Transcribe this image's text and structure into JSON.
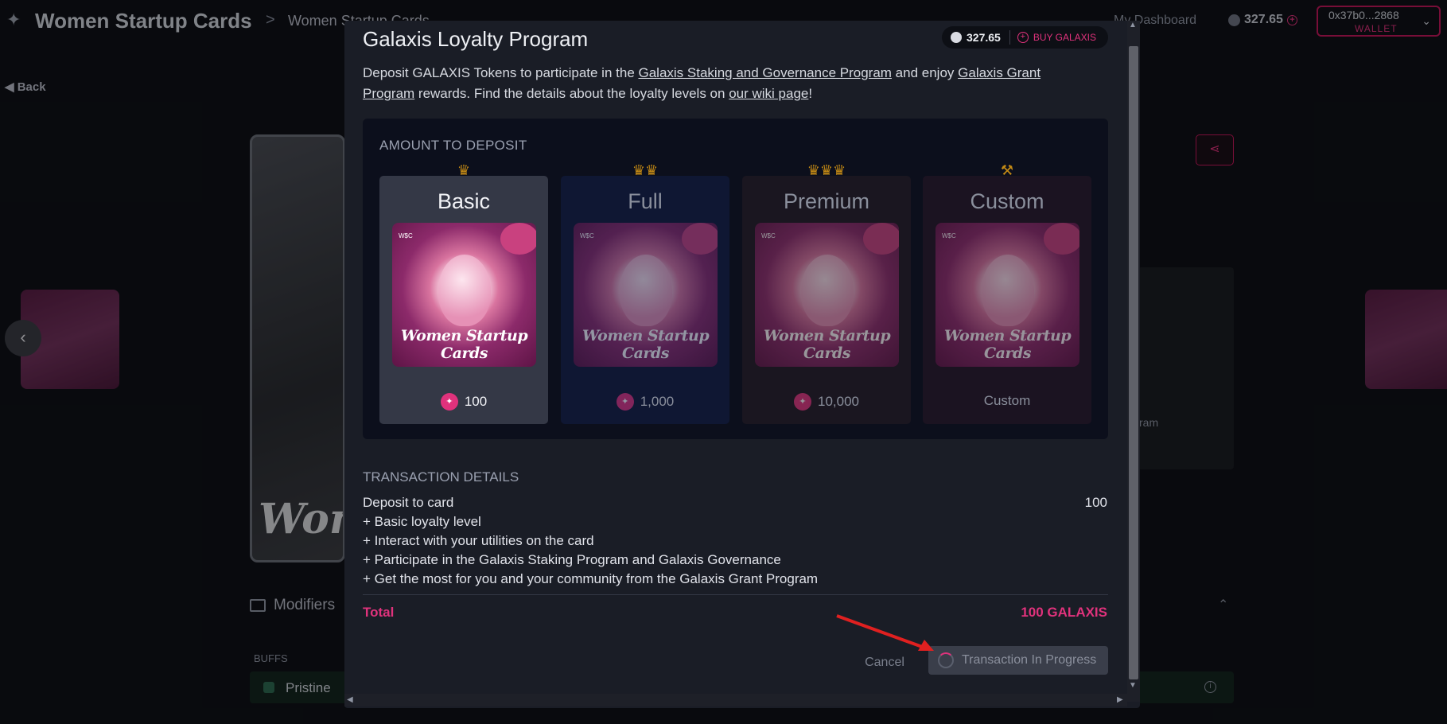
{
  "header": {
    "app_title": "Women Startup Cards",
    "breadcrumb_sep": ">",
    "breadcrumb": "Women Startup Cards",
    "nav_dashboard": "My Dashboard",
    "balance": "327.65",
    "wallet_address": "0x37b0...2868",
    "wallet_label": "WALLET"
  },
  "page": {
    "back_label": "◀ Back",
    "card_text": "Wom",
    "side_panel_text": "ram",
    "modifiers_label": "Modifiers",
    "buffs_label": "BUFFS",
    "pristine_label": "Pristine"
  },
  "modal": {
    "title": "Galaxis Loyalty Program",
    "balance": "327.65",
    "buy_label": "BUY GALAXIS",
    "intro": {
      "t1": "Deposit GALAXIS Tokens to participate in the ",
      "link1": "Galaxis Staking and Governance Program",
      "t2": " and enjoy ",
      "link2": "Galaxis Grant Program",
      "t3": " rewards. Find the details about the loyalty levels on ",
      "link3": "our wiki page",
      "t4": "!"
    },
    "deposit_title": "AMOUNT TO DEPOSIT",
    "card_caption": "Women Startup Cards",
    "tiers": [
      {
        "name": "Basic",
        "price": "100",
        "crown": "♛"
      },
      {
        "name": "Full",
        "price": "1,000",
        "crown": "♛♛"
      },
      {
        "name": "Premium",
        "price": "10,000",
        "crown": "♛♛♛"
      },
      {
        "name": "Custom",
        "price": "Custom",
        "crown": "⚒"
      }
    ],
    "tx_title": "TRANSACTION DETAILS",
    "tx_deposit_label": "Deposit to card",
    "tx_deposit_value": "100",
    "tx_lines": [
      "+ Basic loyalty level",
      "+ Interact with your utilities on the card",
      "+ Participate in the Galaxis Staking Program and Galaxis Governance",
      "+ Get the most for you and your community from the Galaxis Grant Program"
    ],
    "total_label": "Total",
    "total_value": "100 GALAXIS",
    "cancel_label": "Cancel",
    "progress_label": "Transaction In Progress"
  },
  "colors": {
    "accent": "#e0327c",
    "crown": "#c48a15",
    "modal_bg": "#1a1d26"
  }
}
